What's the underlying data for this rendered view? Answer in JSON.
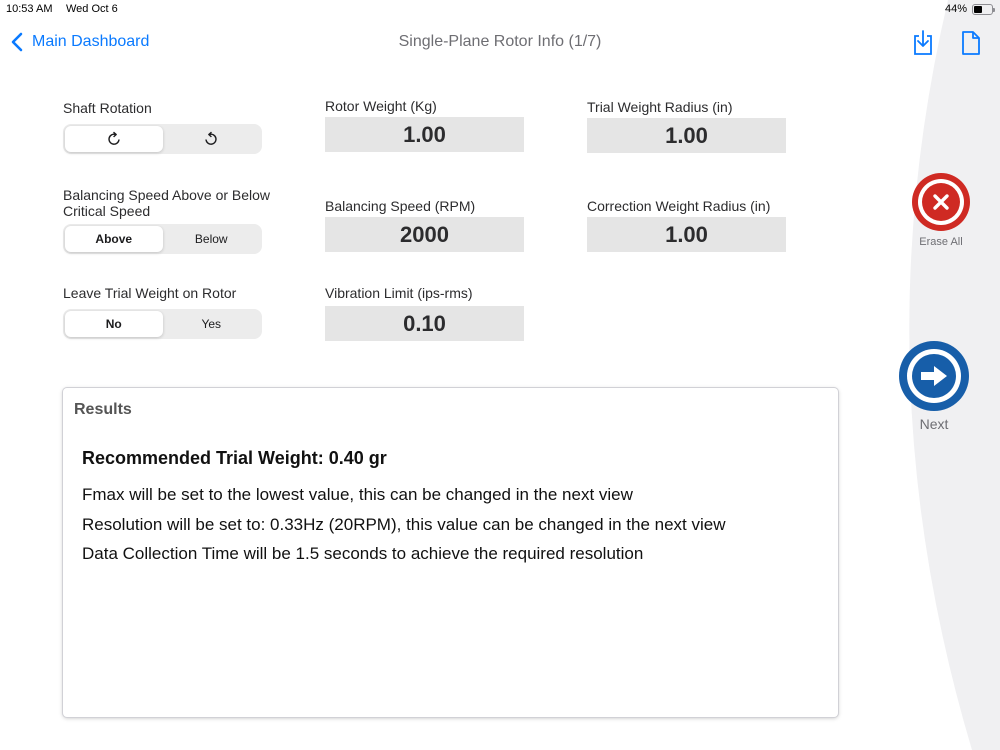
{
  "status_bar": {
    "time": "10:53 AM",
    "date": "Wed Oct 6",
    "battery": "44%"
  },
  "nav": {
    "back_label": "Main Dashboard",
    "title": "Single-Plane Rotor Info (1/7)",
    "icons": [
      "download-icon",
      "document-icon"
    ]
  },
  "form": {
    "shaft_rotation": {
      "label": "Shaft Rotation",
      "options": [
        "clockwise-icon",
        "counterclockwise-icon"
      ],
      "selected_index": 0
    },
    "critical_speed": {
      "label_line1": "Balancing Speed Above or Below",
      "label_line2": "Critical Speed",
      "options": [
        "Above",
        "Below"
      ],
      "selected_index": 0
    },
    "leave_trial_weight": {
      "label": "Leave Trial Weight on Rotor",
      "options": [
        "No",
        "Yes"
      ],
      "selected_index": 0
    },
    "rotor_weight": {
      "label": "Rotor Weight (Kg)",
      "value": "1.00"
    },
    "balancing_speed": {
      "label": "Balancing Speed (RPM)",
      "value": "2000"
    },
    "vibration_limit": {
      "label": "Vibration Limit (ips-rms)",
      "value": "0.10"
    },
    "trial_weight_radius": {
      "label": "Trial Weight Radius (in)",
      "value": "1.00"
    },
    "correction_weight_radius": {
      "label": "Correction Weight Radius (in)",
      "value": "1.00"
    }
  },
  "actions": {
    "erase_label": "Erase All",
    "next_label": "Next"
  },
  "results": {
    "title": "Results",
    "headline": "Recommended Trial Weight: 0.40 gr",
    "lines": [
      "Fmax will be set to the lowest value, this can be changed in the next view",
      "Resolution will be set to: 0.33Hz (20RPM), this value can be changed in the next view",
      "Data Collection Time will be 1.5 seconds to achieve the required resolution"
    ]
  },
  "colors": {
    "accent": "#0a7aff",
    "erase": "#cf2a23",
    "next": "#175ea9",
    "field_bg": "#e5e5e5",
    "side_panel_bg": "#f0f0f2"
  }
}
